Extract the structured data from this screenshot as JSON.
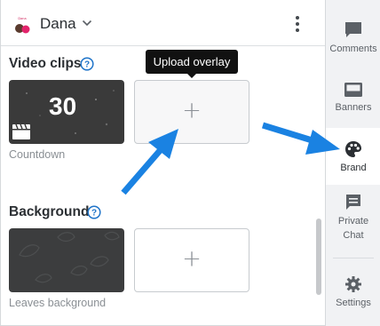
{
  "header": {
    "profile_name": "Dana",
    "avatar_text": "Dana"
  },
  "tooltip": {
    "text": "Upload overlay"
  },
  "video_clips": {
    "title": "Video clips",
    "items": [
      {
        "caption": "Countdown",
        "thumb_text": "30"
      }
    ],
    "add_label": "+"
  },
  "background": {
    "title": "Background",
    "items": [
      {
        "caption": "Leaves background"
      }
    ],
    "add_label": "+"
  },
  "sidebar": {
    "items": [
      {
        "label": "Comments",
        "icon": "comment-icon"
      },
      {
        "label": "Banners",
        "icon": "banner-icon"
      },
      {
        "label": "Brand",
        "icon": "palette-icon",
        "active": true
      },
      {
        "label": "Private Chat",
        "icon": "chat-icon"
      },
      {
        "label": "Settings",
        "icon": "gear-icon"
      }
    ]
  },
  "colors": {
    "accent_arrow": "#1a82e2",
    "tooltip_bg": "#111111",
    "sidebar_bg": "#f1f2f4"
  }
}
